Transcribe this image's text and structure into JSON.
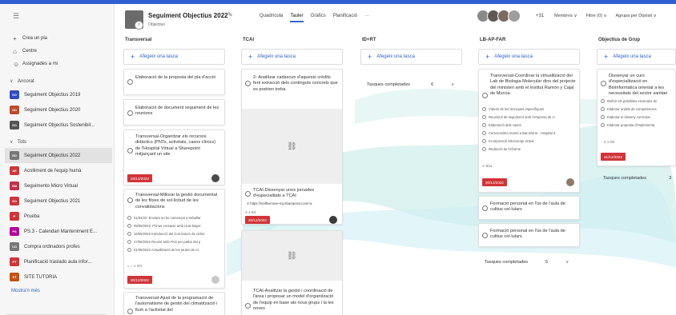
{
  "sidebar": {
    "nav": [
      {
        "label": "Crea un pla",
        "icon": "plus-icon"
      },
      {
        "label": "Centre",
        "icon": "home-icon"
      },
      {
        "label": "Assignades a mi",
        "icon": "person-icon"
      }
    ],
    "pinned_heading": "Ancorat",
    "pinned": [
      {
        "label": "Seguiment Objectius 2019",
        "badge": "SO",
        "color": "#2f4bc5"
      },
      {
        "label": "Seguiment Objectius 2020",
        "badge": "SO",
        "color": "#c14a2c"
      },
      {
        "label": "Seguiment Objectius Sostenibil...",
        "badge": "SO",
        "color": "#555555"
      }
    ],
    "all_heading": "Tots",
    "all": [
      {
        "label": "Seguiment Objectius 2022",
        "badge": "SO",
        "color": "#777777",
        "selected": true
      },
      {
        "label": "Acolliment de l'equip humà",
        "badge": "AE",
        "color": "#d13438"
      },
      {
        "label": "Seguimento Micro Virtual",
        "badge": "SM",
        "color": "#c4314b"
      },
      {
        "label": "Seguiment Objectius 2021",
        "badge": "SO",
        "color": "#d13438"
      },
      {
        "label": "Prueba",
        "badge": "P",
        "color": "#d13438"
      },
      {
        "label": "PS.3 - Calendari Manteniment E...",
        "badge": "PS",
        "color": "#b4009e"
      },
      {
        "label": "Compra ordinadors profes",
        "badge": "CO",
        "color": "#777777"
      },
      {
        "label": "Planificació traslado aula infor...",
        "badge": "PT",
        "color": "#d13438"
      },
      {
        "label": "SITE TUTORIA",
        "badge": "ST",
        "color": "#ca5010"
      }
    ],
    "more_label": "Mostra'n més"
  },
  "header": {
    "logo_badge": "i",
    "title": "Seguiment Objectius 2022",
    "subtitle": "Objectius",
    "views": [
      "Quadrícula",
      "Tauler",
      "Gràfics",
      "Planificació",
      "···"
    ],
    "active_view": "Tauler",
    "member_count": "+31",
    "filters": [
      "Membres ∨",
      "Filtre (0) ∨",
      "Agrupa per Dipòsit ∨"
    ]
  },
  "add_task_label": "Afegeix una tasca",
  "colors": {
    "accent": "#2b5fc7",
    "late": "#d13438",
    "topbar": "#2f5fcf"
  },
  "columns": [
    {
      "title": "Transversal"
    },
    {
      "title": "TCAI"
    },
    {
      "title": "ID+RT"
    },
    {
      "title": "LB-AP-FAR"
    },
    {
      "title": "Objectius de Grup"
    }
  ],
  "cards": {
    "t1": "Elaboració de la proposta del pla d'acció",
    "t2": "Elaboració de document seguiment de les reunions",
    "t3": "Transversal-Organitzar els recursos didàctics (PNTs, activitats, casos clínics) de l'Hospital Virtual a Sharepoint mitjançant un site.",
    "t3_date": "20/12/2022",
    "t4": "Transversal-Millorar la gestió documental de les fitxes de sol·licitud de les convalidacions",
    "t4_subs": [
      "01/04/22: Enviara no he començat a treballar",
      "09/05/2022: Primer contacte amb Lluis Bayer",
      "16/05/2022 Introducció del Currículum de cicles",
      "27/05/2022 Reunió amb PAS per parlar del p",
      "01/09/2022 Actualització de les taules de co"
    ],
    "t4_meta": "0/4",
    "t4_date": "20/12/2022",
    "t5": "Transversal-Ajust de la programació de l'automatisme de gestió del climatització i llum a l'activitat del",
    "c1": "2- Analitzar cadascun d'aquests crèdits fent extracció dels continguts concrets que es podrien treba",
    "c2": "TCAI-Dissenyar unes jornades d'especialitats a TCAI",
    "c2_link": "https://mollbornove-my.sharepoint.com/:w",
    "c2_meta": "2   0/4",
    "c2_date": "20/12/2022",
    "c3": "TCAI-Analitzar la gestió i coordinació de l'àrea i proposar un model d'organització de l'equip en base als nous grups i la les noves",
    "i1": "Tasques completades",
    "i1_count": "6",
    "l1": "Transversal-Coordinar la virtualització del Lab de Biologia Molecular dins del projecte del ministeri amb el Institut Ramón y Cajal de Murcia",
    "l1_subs": [
      "Vídeos de les tècniques específiques",
      "Reunions de seguiment amb l'empresa de vi",
      "Elaboració dels casos",
      "Convocatòria reunió a Barcelona - Hospital d",
      "Incorporació Microscopi virtual",
      "Redacció de l'informe"
    ],
    "l1_meta": "6/11",
    "l1_date": "20/12/2022",
    "l2": "Formació personal en l'ús de l'aula de cultius cel·lulars",
    "l3": "Formació personal en l'ús de l'aula de cultius cel·lulars",
    "l_completed": "Tasques completades",
    "l_completed_count": "5",
    "g1": "Dissenyar un curs d'especialització en Bioinformàtica orientat a les necessitats del sector sanitari",
    "g1_subs": [
      "Definir els possibles escenaris de",
      "Elaborar anàlisi de competències",
      "Elaborar el disseny curricular",
      "Elaborar proposta d'implementa"
    ],
    "g1_meta": "1   0/4",
    "g1_date": "31/12/2022",
    "g_completed": "Tasques completades",
    "g_completed_count": "3"
  }
}
